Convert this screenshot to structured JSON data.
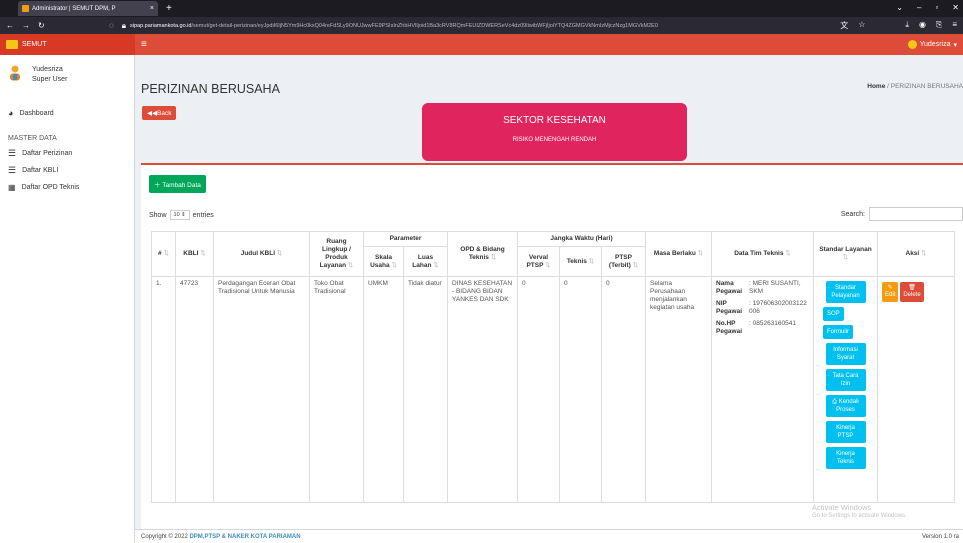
{
  "browser": {
    "tab_title": "Administrator | SEMUT DPM, P",
    "tab_close": "×",
    "new_tab": "+",
    "url_domain": "sipap.pariamankota.go.id",
    "url_path": "/semut/get-detail-perizinan/eyJpdiI6IjN5Ym9Hc0kxQ04reFdSLy9ONUJwwFE9PSIsInZhbHVlIjoid1Ba3cRV8RQmFEUIZDWERSeVc4dz09IiwibWFjIjoiYTQ4ZGMGVkNmIzMjczNzg1MGVkM2E0"
  },
  "app": {
    "brand": "SEMUT",
    "user_top": "Yudesriza",
    "user_name": "Yudesriza",
    "user_role": "Super User"
  },
  "sidebar": {
    "dashboard": "Dashboard",
    "section": "MASTER DATA",
    "items": [
      {
        "label": "Daftar Perizinan"
      },
      {
        "label": "Daftar KBLI"
      },
      {
        "label": "Daftar OPD Teknis"
      }
    ]
  },
  "page": {
    "title": "PERIZINAN BERUSAHA",
    "crumb_home": "Home",
    "crumb_sep": "/",
    "crumb_current": "PERIZINAN BERUSAHA",
    "back": "Back",
    "sektor_title": "SEKTOR KESEHATAN",
    "sektor_sub": "RISIKO MENENGAH RENDAH",
    "add": "Tambah Data",
    "show": "Show",
    "entries_value": "10",
    "entries": "entries",
    "search": "Search:"
  },
  "table": {
    "headers": {
      "no": "#",
      "kbli": "KBLI",
      "judul": "Judul KBLI",
      "ruang": "Ruang Lingkup / Produk Layanan",
      "parameter": "Parameter",
      "skala": "Skala Usaha",
      "luas": "Luas Lahan",
      "opd": "OPD & Bidang Teknis",
      "jangka": "Jangka Waktu (Hari)",
      "verval": "Verval PTSP",
      "teknis": "Teknis",
      "ptsp": "PTSP (Terbit)",
      "masa": "Masa Berlaku",
      "tim": "Data Tim Teknis",
      "standar": "Standar Layanan",
      "aksi": "Aksi"
    },
    "row": {
      "no": "1.",
      "kbli": "47723",
      "judul": "Perdagangan Eceran Obat Tradisional Untuk Manusia",
      "ruang": "Toko Obat Tradisional",
      "skala": "UMKM",
      "luas": "Tidak diatur",
      "opd": "DINAS KESEHATAN - BIDANG BIDAN YANKES DAN SDK",
      "verval": "0",
      "teknis": "0",
      "ptsp": "0",
      "masa": "Selama Perusahaan menjalankan kegiatan usaha",
      "tim_nama_label": "Nama Pegawai",
      "tim_nama": ": MERI SUSANTI, SKM",
      "tim_nip_label": "NIP Pegawai",
      "tim_nip": ": 197606302003122006",
      "tim_hp_label": "No.HP Pegawai",
      "tim_hp": ": 085263160541",
      "standar_buttons": [
        "Standar Pelayanan",
        "SOP",
        "Formulir",
        "Informasi Syarat",
        "Tata Cara Izin",
        "Kendali Proses",
        "Kinerja PTSP",
        "Kinerja Teknis"
      ],
      "edit": "Edit",
      "delete": "Delete"
    }
  },
  "footer": {
    "copyright": "Copyright © 2022",
    "org": "DPM,PTSP & NAKER KOTA PARIAMAN",
    "version": "Version 1.0 ra"
  },
  "watermark": {
    "line1": "Activate Windows",
    "line2": "Go to Settings to activate Windows."
  }
}
